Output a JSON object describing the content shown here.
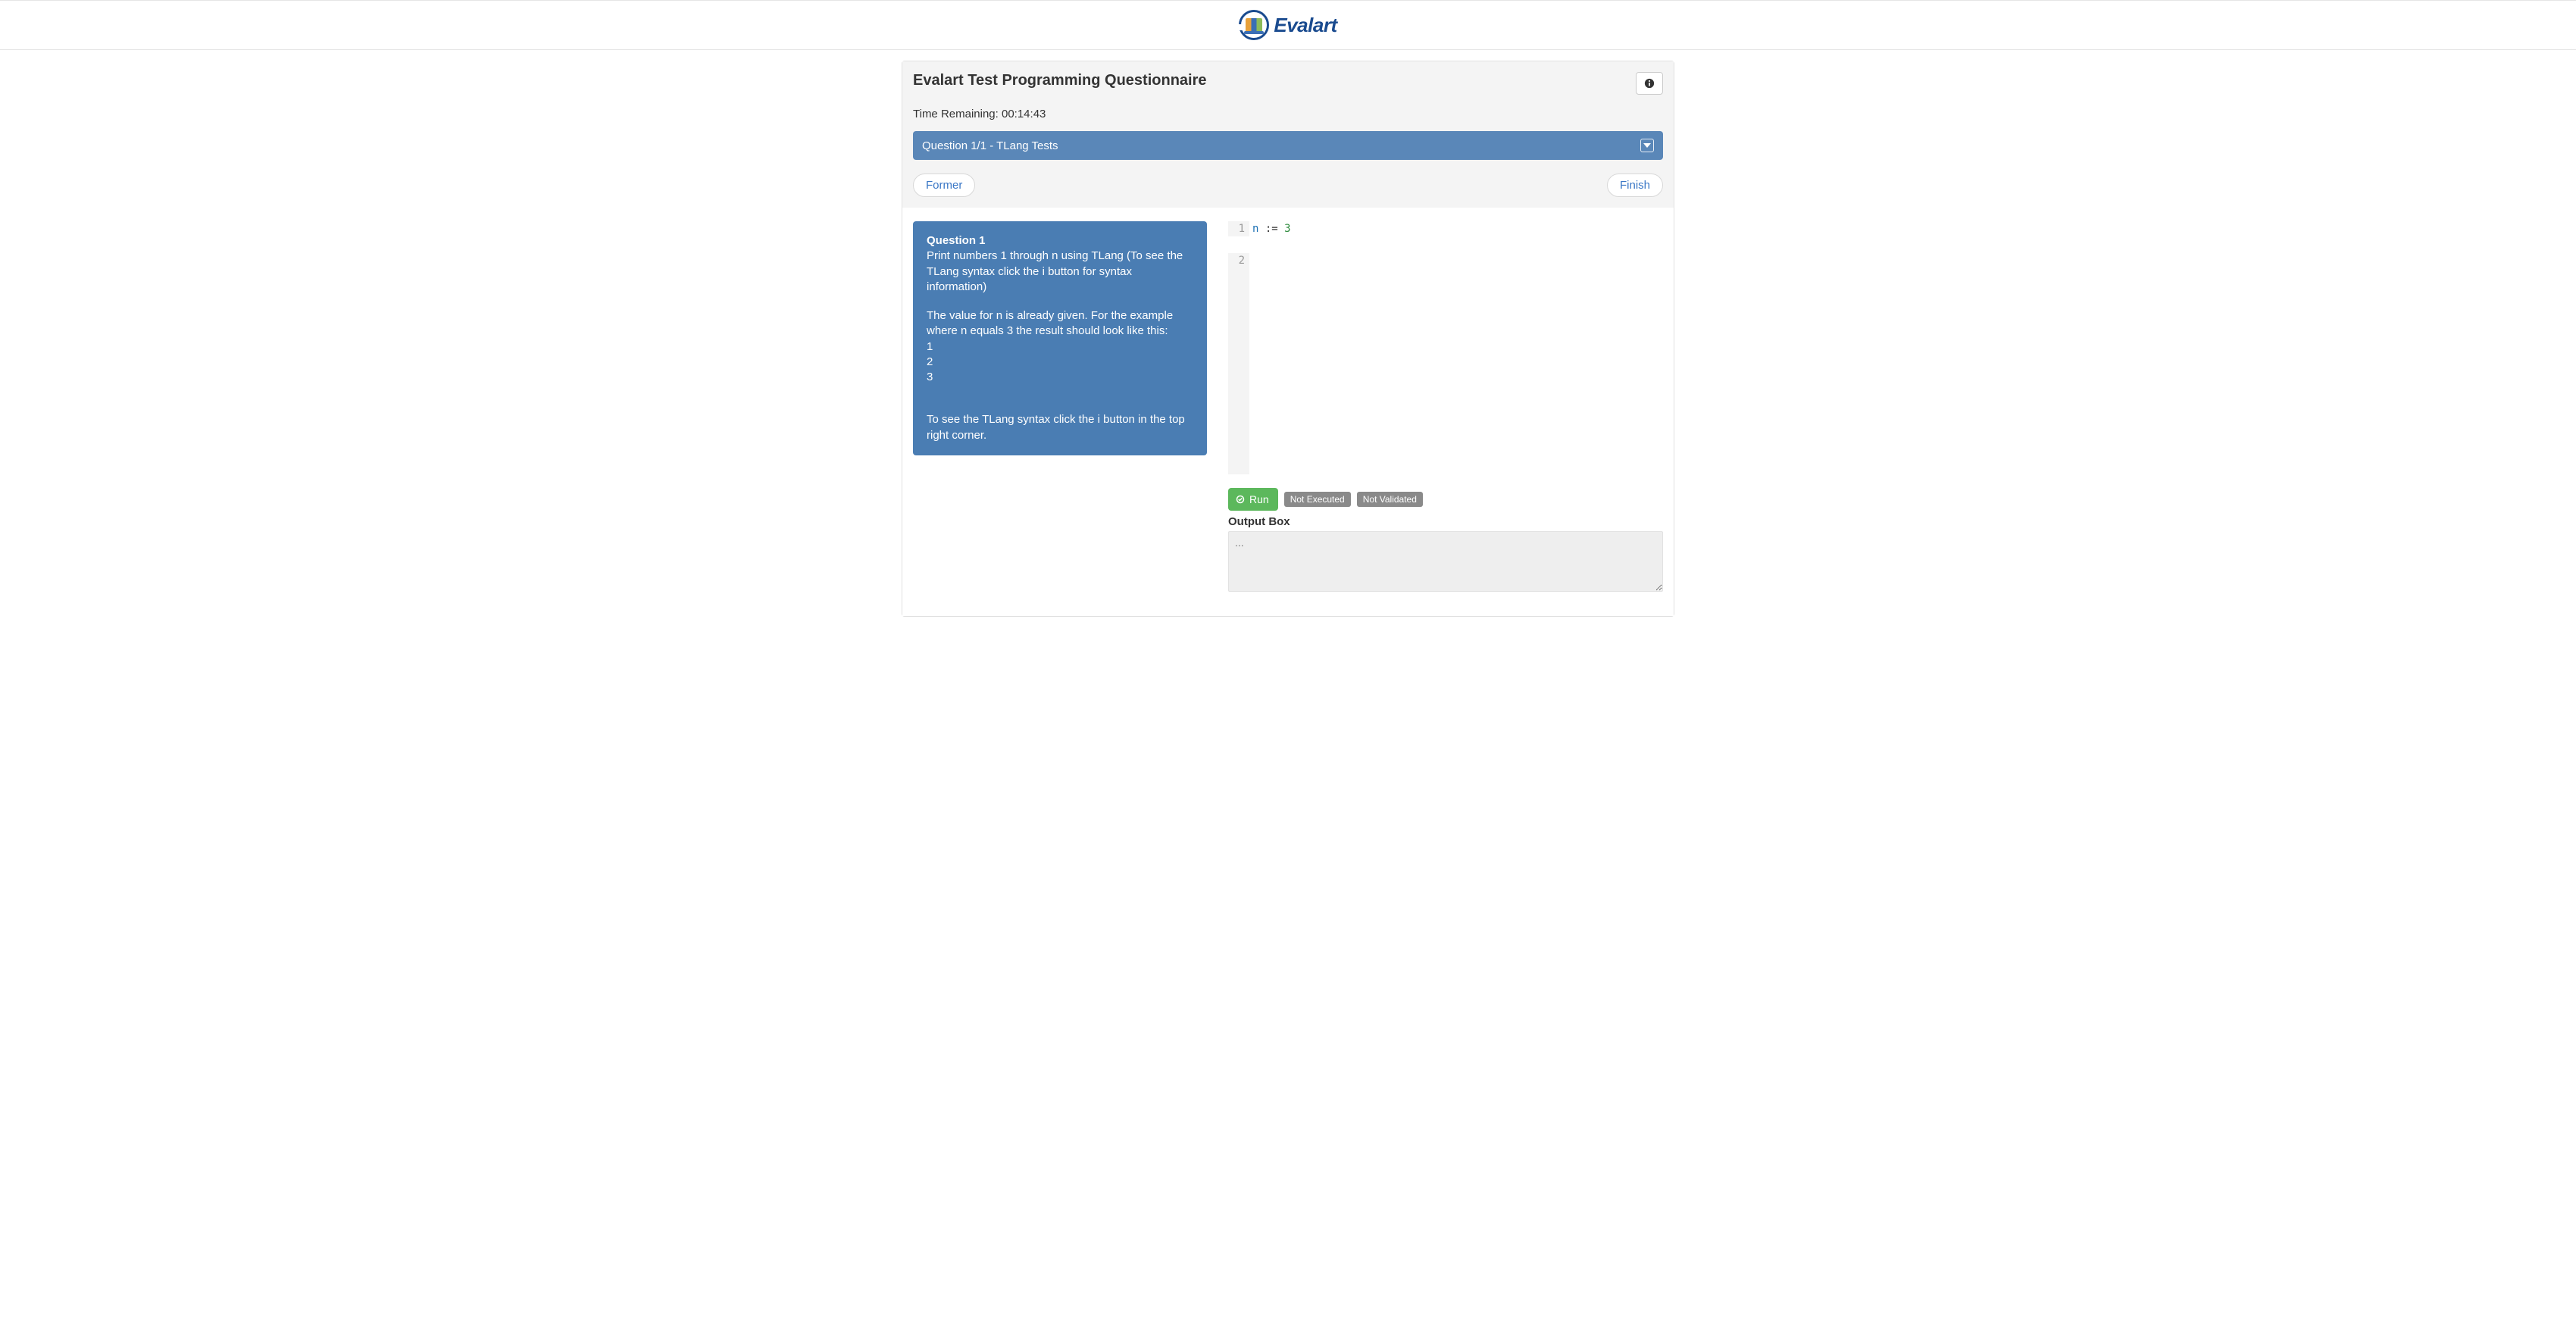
{
  "logo": {
    "text": "Evalart"
  },
  "header": {
    "title": "Evalart Test Programming Questionnaire",
    "time_label": "Time Remaining: ",
    "time_value": "00:14:43"
  },
  "question_select": {
    "label": "Question 1/1 - TLang Tests"
  },
  "nav": {
    "former": "Former",
    "finish": "Finish"
  },
  "question": {
    "heading": "Question 1",
    "p1": "Print numbers 1 through n using TLang (To see the TLang syntax click the i button for syntax information)",
    "p2": "The value for n is already given. For the example where n equals 3 the result should look like this:",
    "ex1": "1",
    "ex2": "2",
    "ex3": "3",
    "p3": "To see the TLang syntax click the i button in the top right corner."
  },
  "editor": {
    "line1_num": "1",
    "line1_var": "n",
    "line1_op": ":=",
    "line1_val": "3",
    "line2_num": "2"
  },
  "controls": {
    "run": "Run",
    "badge_exec": "Not Executed",
    "badge_valid": "Not Validated",
    "output_label": "Output Box",
    "output_placeholder": "..."
  }
}
